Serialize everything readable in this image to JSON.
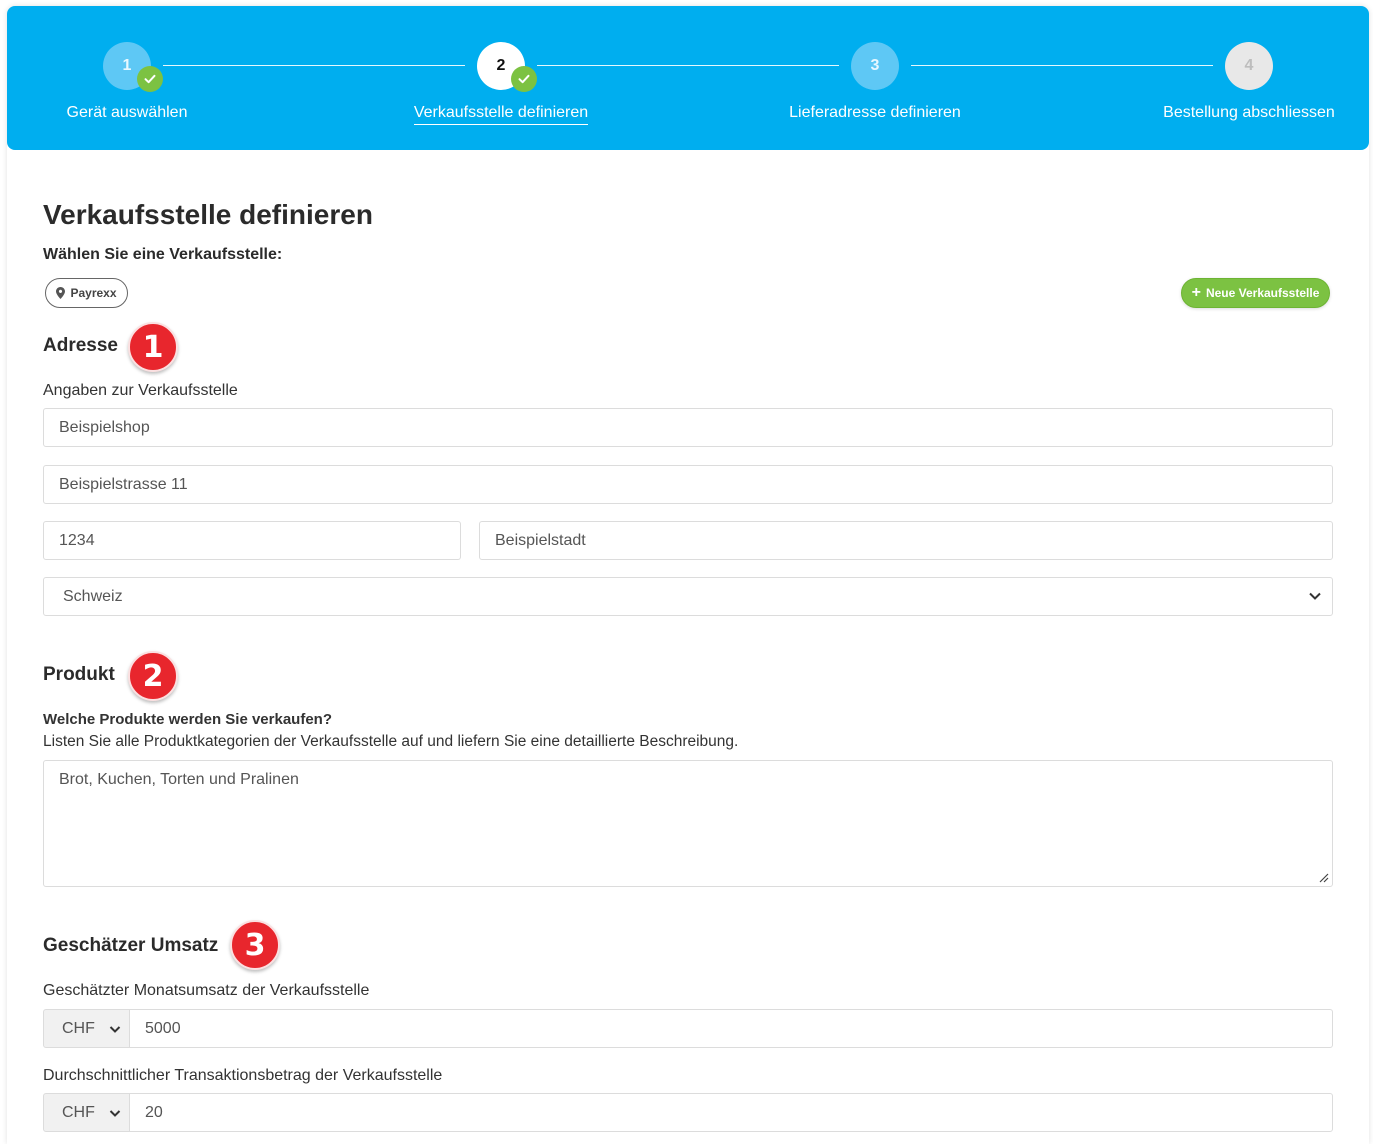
{
  "stepper": {
    "steps": [
      {
        "number": "1",
        "label": "Gerät auswählen",
        "state": "done"
      },
      {
        "number": "2",
        "label": "Verkaufsstelle definieren",
        "state": "current"
      },
      {
        "number": "3",
        "label": "Lieferadresse definieren",
        "state": "pending"
      },
      {
        "number": "4",
        "label": "Bestellung abschliessen",
        "state": "future"
      }
    ]
  },
  "page": {
    "title": "Verkaufsstelle definieren",
    "choose_label": "Wählen Sie eine Verkaufsstelle:",
    "chip_label": "Payrexx",
    "new_button_label": "Neue Verkaufsstelle"
  },
  "address": {
    "title": "Adresse",
    "badge": "1",
    "label": "Angaben zur Verkaufsstelle",
    "name": "Beispielshop",
    "street": "Beispielstrasse 11",
    "zip": "1234",
    "city": "Beispielstadt",
    "country": "Schweiz"
  },
  "product": {
    "title": "Produkt",
    "badge": "2",
    "question": "Welche Produkte werden Sie verkaufen?",
    "hint": "Listen Sie alle Produktkategorien der Verkaufsstelle auf und liefern Sie eine detaillierte Beschreibung.",
    "description": "Brot, Kuchen, Torten und Pralinen"
  },
  "revenue": {
    "title": "Geschätzer Umsatz",
    "badge": "3",
    "monthly_label": "Geschätzter Monatsumsatz der Verkaufsstelle",
    "monthly_currency": "CHF",
    "monthly_value": "5000",
    "avg_label": "Durchschnittlicher Transaktionsbetrag der Verkaufsstelle",
    "avg_currency": "CHF",
    "avg_value": "20"
  },
  "colors": {
    "stepper_bg": "#00aeef",
    "success": "#7cc242",
    "badge_red": "#e8262d"
  },
  "icons": {
    "check": "check-icon",
    "pin": "map-pin-icon",
    "chevron": "chevron-down-icon",
    "plus": "plus-icon"
  }
}
